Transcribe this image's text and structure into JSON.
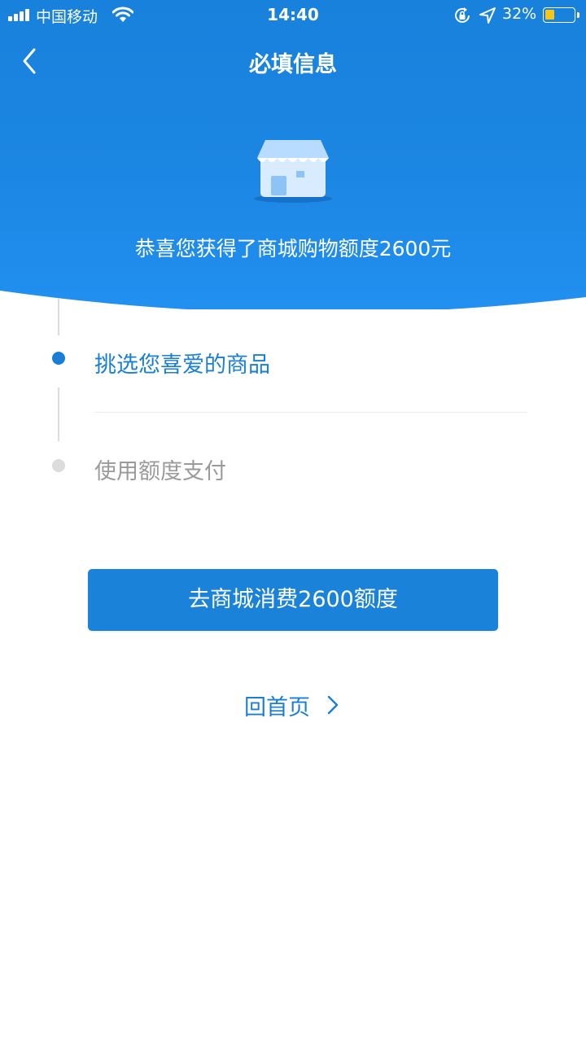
{
  "status_bar": {
    "carrier": "中国移动",
    "time": "14:40",
    "battery_percent": "32%",
    "battery_level": 0.32
  },
  "nav": {
    "title": "必填信息",
    "back_icon": "chevron-left-icon"
  },
  "hero": {
    "illustration": "store-icon",
    "message": "恭喜您获得了商城购物额度2600元"
  },
  "steps": [
    {
      "label": "挑选您喜爱的商品",
      "active": true
    },
    {
      "label": "使用额度支付",
      "active": false
    }
  ],
  "actions": {
    "primary_label": "去商城消费2600额度",
    "home_label": "回首页"
  },
  "colors": {
    "brand_blue": "#1a82d9",
    "active_step": "#1a7fd4",
    "inactive_step": "#9a9a9a",
    "battery_yellow": "#f5c518"
  }
}
